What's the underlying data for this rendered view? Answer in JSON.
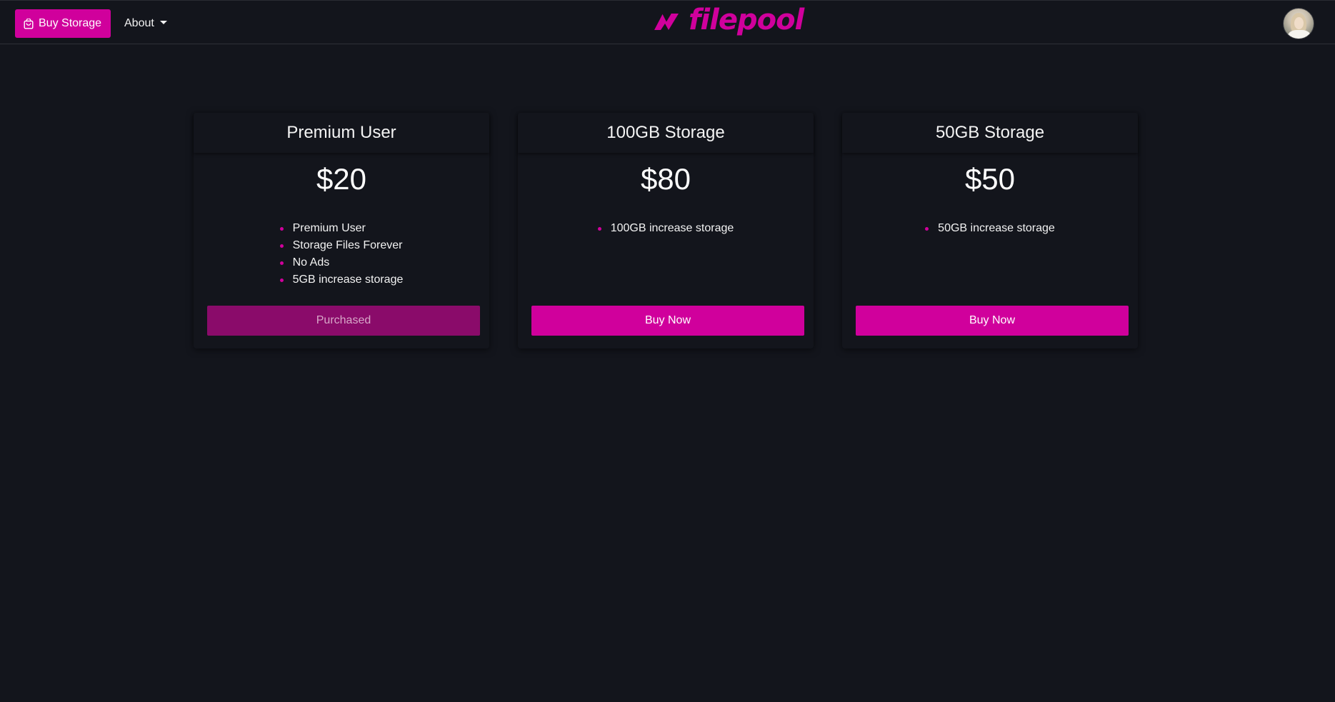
{
  "navbar": {
    "buy_storage_label": "Buy Storage",
    "about_label": "About",
    "brand_name": "filepool",
    "accent_color": "#d0009c"
  },
  "plans": [
    {
      "title": "Premium User",
      "price": "$20",
      "features": [
        "Premium User",
        "Storage Files Forever",
        "No Ads",
        "5GB increase storage"
      ],
      "button_label": "Purchased",
      "button_state": "disabled"
    },
    {
      "title": "100GB Storage",
      "price": "$80",
      "features": [
        "100GB increase storage"
      ],
      "button_label": "Buy Now",
      "button_state": "enabled"
    },
    {
      "title": "50GB Storage",
      "price": "$50",
      "features": [
        "50GB increase storage"
      ],
      "button_label": "Buy Now",
      "button_state": "enabled"
    }
  ],
  "icons": {
    "buy_storage": "shopping-bag-icon",
    "about": "chevron-down-icon",
    "brand": "filepool-logo-icon",
    "avatar": "user-avatar"
  }
}
